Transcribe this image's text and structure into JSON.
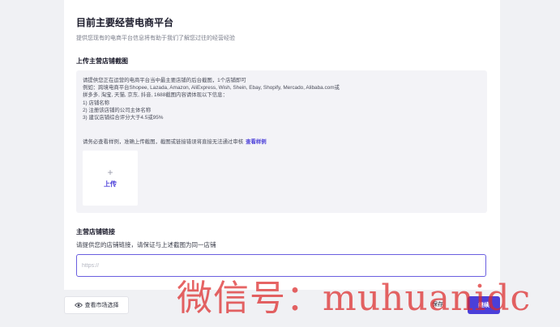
{
  "platform_section": {
    "title": "目前主要经营电商平台",
    "subtitle": "提供您现有的电商平台信息将有助于我们了解您过往的经营经验"
  },
  "upload_section": {
    "title": "上传主营店铺截图",
    "instructions": [
      "请提供您正在运营的电商平台当中最主要店铺的后台截图，1个店铺即可",
      "例如：跨境电商平台Shopee, Lazada, Amazon, AliExpress, Wish, Shein, Ebay, Shopify, Mercado, Alibaba.com或",
      "拼多多, 淘宝, 天猫, 京东, 抖音, 1688截图内容请体现以下信息：",
      "1) 店铺名称",
      "2) 注册该店铺的公司主体名称",
      "3) 建议店铺综合评分大于4.5或95%"
    ],
    "hint": "请务必查看样例，准确上传截图，截图或链接错误将直接无法通过审核",
    "sample_link": "查看样例",
    "upload_plus": "+",
    "upload_label": "上传"
  },
  "link_section": {
    "title": "主营店铺链接",
    "description": "请提供您的店铺链接，请保证与上述截图为同一店铺",
    "placeholder": "https://",
    "value": ""
  },
  "footer": {
    "market_button": "查看市场选择",
    "save_button": "保存",
    "continue_button": "继续"
  },
  "watermark": "微信号：muhuanidc",
  "colors": {
    "accent": "#4b3fd9",
    "watermark": "#dc2828"
  }
}
